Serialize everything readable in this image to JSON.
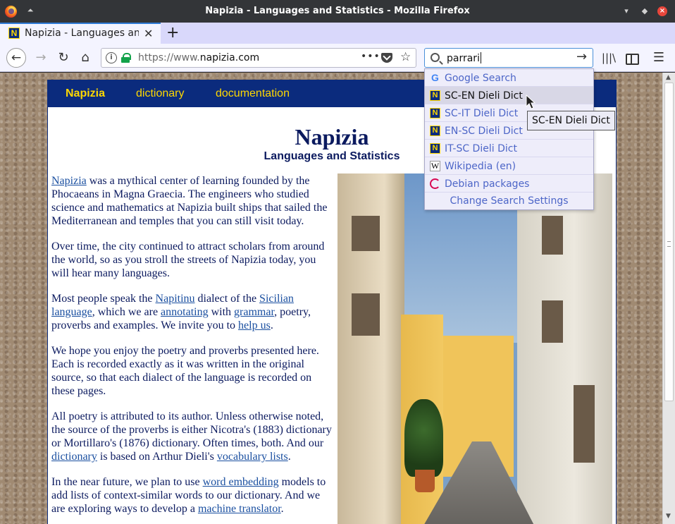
{
  "window": {
    "title": "Napizia - Languages and Statistics - Mozilla Firefox"
  },
  "tab": {
    "favicon": "N",
    "title": "Napizia - Languages and Statistics"
  },
  "urlbar": {
    "url_prefix": "https://www.",
    "url_domain": "napizia.com",
    "more": "•••"
  },
  "searchbar": {
    "query": "parrari"
  },
  "search_dropdown": {
    "engines": [
      {
        "label": "Google Search",
        "icon": "google-icon"
      },
      {
        "label": "SC-EN Dieli Dict",
        "icon": "napizia-icon",
        "selected": true
      },
      {
        "label": "SC-IT Dieli Dict",
        "icon": "napizia-icon"
      },
      {
        "label": "EN-SC Dieli Dict",
        "icon": "napizia-icon"
      },
      {
        "label": "IT-SC Dieli Dict",
        "icon": "napizia-icon"
      },
      {
        "label": "Wikipedia (en)",
        "icon": "wikipedia-icon"
      },
      {
        "label": "Debian packages",
        "icon": "debian-icon"
      }
    ],
    "settings_label": "Change Search Settings",
    "tooltip": "SC-EN Dieli Dict"
  },
  "site": {
    "nav": {
      "brand": "Napizia",
      "dictionary": "dictionary",
      "documentation": "documentation"
    },
    "title": "Napizia",
    "subtitle": "Languages and Statistics",
    "p1": {
      "link": "Napizia",
      "text": " was a mythical center of learning founded by the Phocaeans in Magna Graecia. The engineers who studied science and mathematics at Napizia built ships that sailed the Mediterranean and temples that you can still visit today."
    },
    "p2": "Over time, the city continued to attract scholars from around the world, so as you stroll the streets of Napizia today, you will hear many languages.",
    "p3": {
      "t1": "Most people speak the ",
      "l1": "Napitinu",
      "t2": " dialect of the ",
      "l2": "Sicilian language",
      "t3": ", which we are ",
      "l3": "annotating",
      "t4": " with ",
      "l4": "grammar",
      "t5": ", poetry, proverbs and examples. We invite you to ",
      "l5": "help us",
      "t6": "."
    },
    "p4": "We hope you enjoy the poetry and proverbs presented here. Each is recorded exactly as it was written in the original source, so that each dialect of the language is recorded on these pages.",
    "p5": {
      "t1": "All poetry is attributed to its author. Unless otherwise noted, the source of the proverbs is either Nicotra's (1883) dictionary or Mortillaro's (1876) dictionary. Often times, both. And our ",
      "l1": "dictionary",
      "t2": " is based on Arthur Dieli's ",
      "l2": "vocabulary lists",
      "t3": "."
    },
    "p6": {
      "t1": "In the near future, we plan to use ",
      "l1": "word embedding",
      "t2": " models to add lists of context-similar words to our dictionary. And we are exploring ways to develop a ",
      "l2": "machine translator",
      "t3": "."
    }
  }
}
